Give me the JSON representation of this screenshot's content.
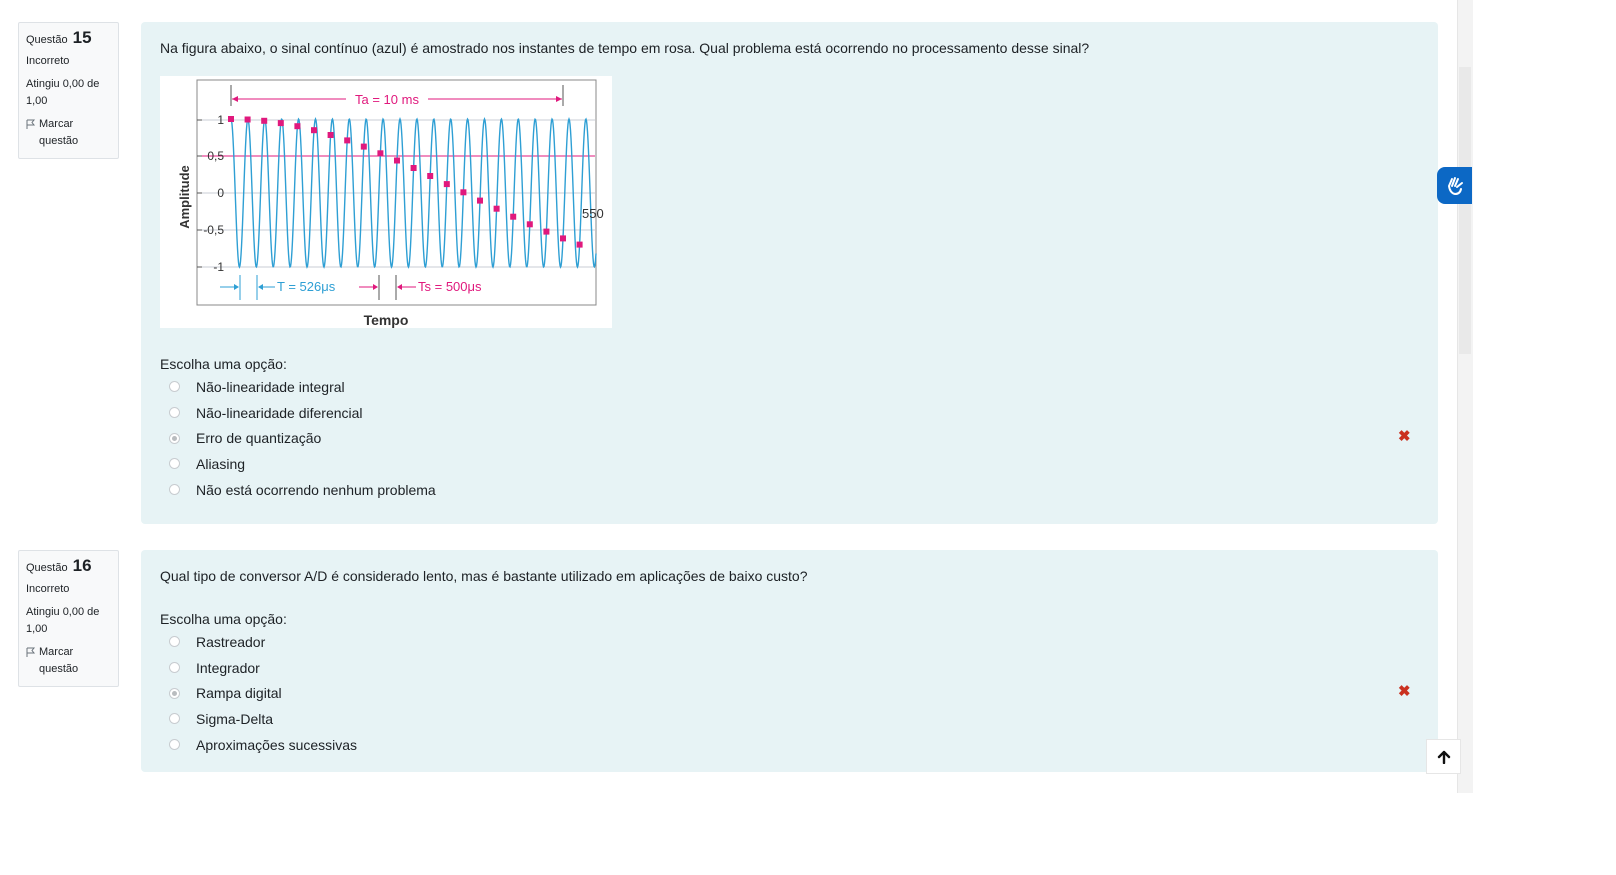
{
  "questions": [
    {
      "number": "15",
      "label": "Questão",
      "state": "Incorreto",
      "grade": "Atingiu 0,00 de 1,00",
      "flag": "Marcar questão",
      "text": "Na figura abaixo, o sinal contínuo (azul) é amostrado nos instantes de tempo em rosa. Qual problema está ocorrendo no processamento desse sinal?",
      "prompt": "Escolha uma opção:",
      "options": [
        "Não-linearidade integral",
        "Não-linearidade diferencial",
        "Erro de quantização",
        "Aliasing",
        "Não está ocorrendo nenhum problema"
      ],
      "selected": 2,
      "result_icon": "cross-icon"
    },
    {
      "number": "16",
      "label": "Questão",
      "state": "Incorreto",
      "grade": "Atingiu 0,00 de 1,00",
      "flag": "Marcar questão",
      "text": "Qual tipo de conversor A/D é considerado lento, mas é bastante utilizado em aplicações de baixo custo?",
      "prompt": "Escolha uma opção:",
      "options": [
        "Rastreador",
        "Integrador",
        "Rampa digital",
        "Sigma-Delta",
        "Aproximações sucessivas"
      ],
      "selected": 2,
      "result_icon": "cross-icon"
    }
  ],
  "figure": {
    "ylabel": "Amplitude",
    "xlabel": "Tempo",
    "yticks": [
      "1",
      "0,5",
      "0",
      "-0,5",
      "-1"
    ],
    "ta_label": "Ta = 10 ms",
    "t_label": "T = 526μs",
    "ts_label": "Ts = 500μs",
    "end_label": "550",
    "signal_color": "#2e9fd4",
    "sample_color": "#e0197d"
  },
  "colors": {
    "question_bg": "#e7f3f5",
    "info_bg": "#f8f9fa",
    "wrong": "#ca3120",
    "accessibility": "#0c68c5"
  },
  "widgets": {
    "accessibility_icon": "hand-sign-icon",
    "back_to_top_icon": "arrow-up-icon"
  }
}
